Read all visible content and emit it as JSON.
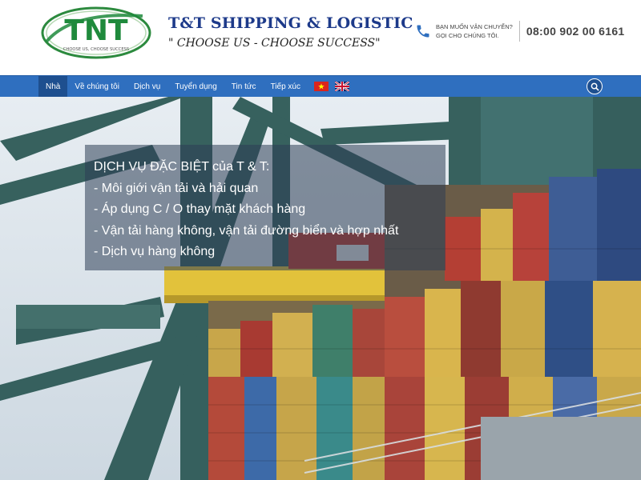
{
  "header": {
    "logo_text": "TNT",
    "logo_tagline": "CHOOSE US, CHOOSE SUCCESS",
    "brand_name": "T&T SHIPPING & LOGISTIC",
    "slogan": "\" CHOOSE US - CHOOSE SUCCESS\"",
    "contact_line1": "BẠN MUỐN VẬN CHUYỂN?",
    "contact_line2": "GỌI CHO CHÚNG TÔI.",
    "phone": "08:00 902 00 6161",
    "icon": "phone-icon"
  },
  "nav": {
    "items": [
      {
        "label": "Nhà",
        "active": true
      },
      {
        "label": "Về chúng tôi",
        "active": false
      },
      {
        "label": "Dịch vụ",
        "active": false
      },
      {
        "label": "Tuyển dụng",
        "active": false
      },
      {
        "label": "Tin tức",
        "active": false
      },
      {
        "label": "Tiếp xúc",
        "active": false
      }
    ],
    "flags": [
      "vietnam-flag-icon",
      "uk-flag-icon"
    ],
    "search_icon": "search-icon"
  },
  "hero": {
    "title": "DỊCH VỤ ĐẶC BIỆT của T & T:",
    "services": [
      "- Môi giới vận tải và hải quan",
      "- Áp dụng C / O thay mặt khách hàng",
      "- Vận tải hàng không, vận tải đường biển và hợp nhất",
      "- Dịch vụ hàng không"
    ],
    "image": "container-port-photo"
  },
  "colors": {
    "nav_bg": "#2f6fbf",
    "nav_active": "#1e4f8f",
    "brand_blue": "#1d3a8a",
    "logo_green": "#1f8a3c"
  }
}
